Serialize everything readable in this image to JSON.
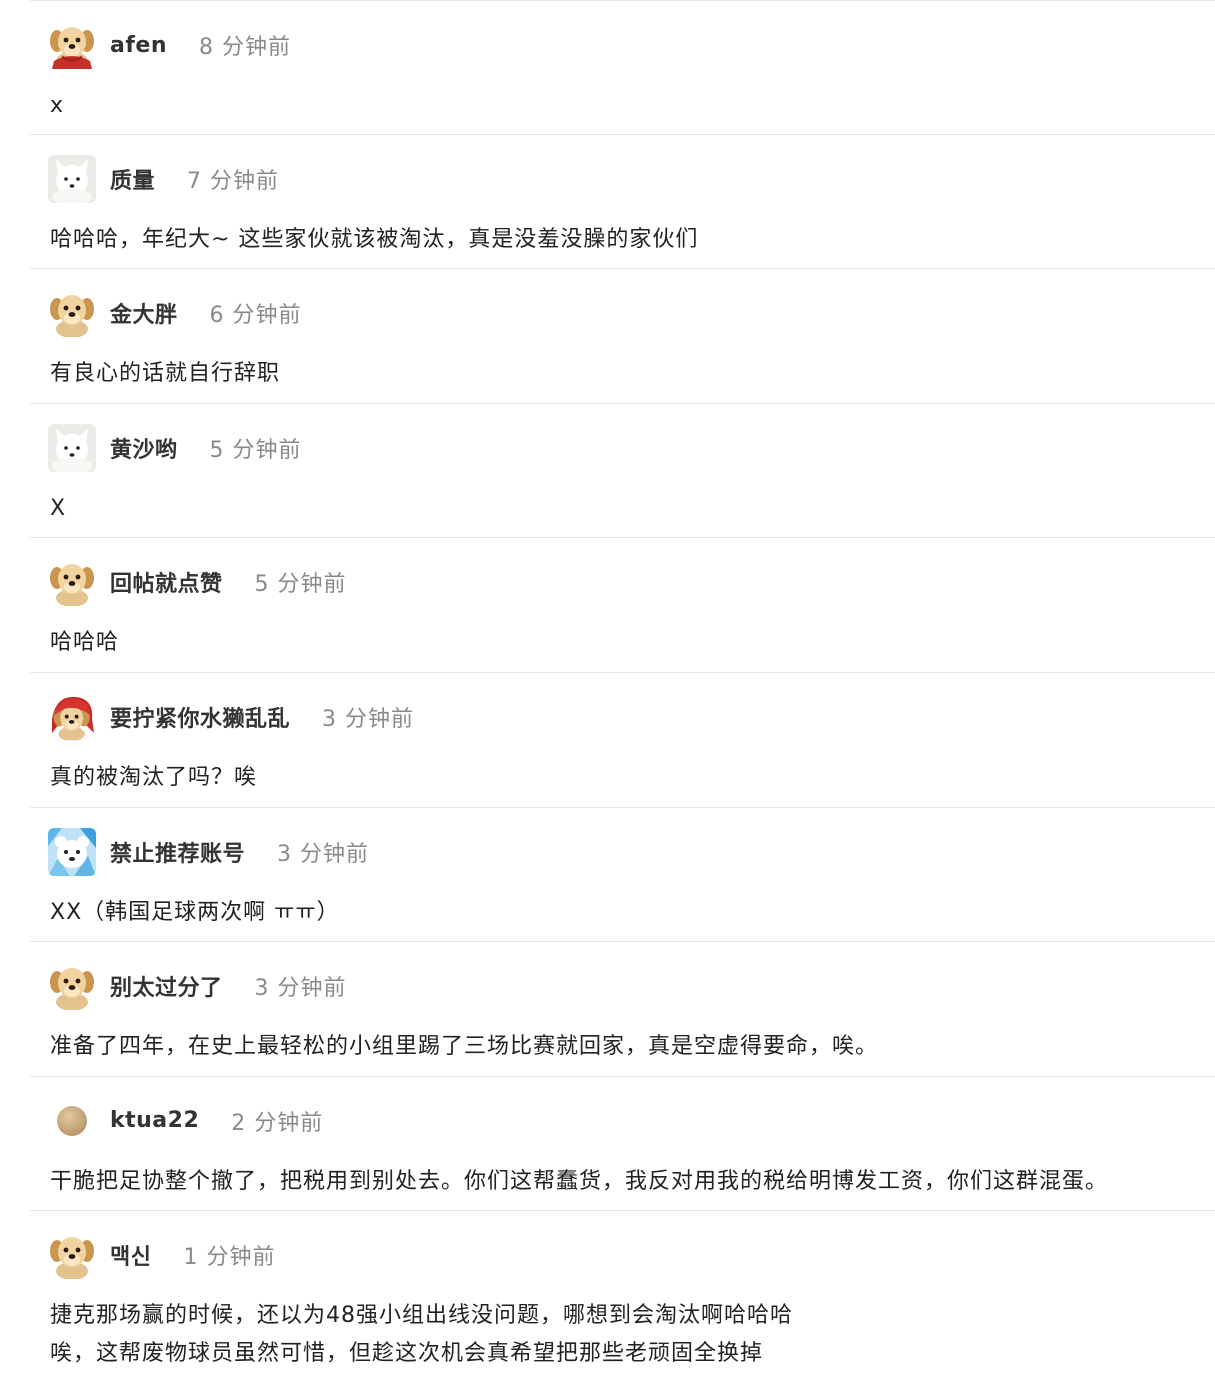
{
  "comments": [
    {
      "avatar": "puppy-scarf-avatar",
      "username": "afen",
      "time": "8 分钟前",
      "lines": [
        "x"
      ]
    },
    {
      "avatar": "white-fox-avatar",
      "username": "质量",
      "time": "7 分钟前",
      "lines": [
        "哈哈哈，年纪大~ 这些家伙就该被淘汰，真是没羞没臊的家伙们"
      ]
    },
    {
      "avatar": "puppy-avatar",
      "username": "金大胖",
      "time": "6 分钟前",
      "lines": [
        "有良心的话就自行辞职"
      ]
    },
    {
      "avatar": "white-fox-avatar",
      "username": "黄沙哟",
      "time": "5 分钟前",
      "lines": [
        "X"
      ]
    },
    {
      "avatar": "puppy-avatar",
      "username": "回帖就点赞",
      "time": "5 分钟前",
      "lines": [
        "哈哈哈"
      ]
    },
    {
      "avatar": "puppy-red-hood-avatar",
      "username": "要拧紧你水獭乱乱",
      "time": "3 分钟前",
      "lines": [
        "真的被淘汰了吗？唉"
      ]
    },
    {
      "avatar": "polar-bear-avatar",
      "username": "禁止推荐账号",
      "time": "3 分钟前",
      "lines": [
        "XX（韩国足球两次啊 ㅠㅠ）"
      ]
    },
    {
      "avatar": "puppy-avatar",
      "username": "别太过分了",
      "time": "3 分钟前",
      "lines": [
        "准备了四年，在史上最轻松的小组里踢了三场比赛就回家，真是空虚得要命，唉。"
      ]
    },
    {
      "avatar": "tan-circle-avatar",
      "username": "ktua22",
      "time": "2 分钟前",
      "lines": [
        "干脆把足协整个撤了，把税用到别处去。你们这帮蠢货，我反对用我的税给明博发工资，你们这群混蛋。"
      ]
    },
    {
      "avatar": "puppy-avatar",
      "username": "맥신",
      "time": "1 分钟前",
      "lines": [
        "捷克那场赢的时候，还以为48强小组出线没问题，哪想到会淘汰啊哈哈哈",
        "唉，这帮废物球员虽然可惜，但趁这次机会真希望把那些老顽固全换掉"
      ]
    }
  ]
}
